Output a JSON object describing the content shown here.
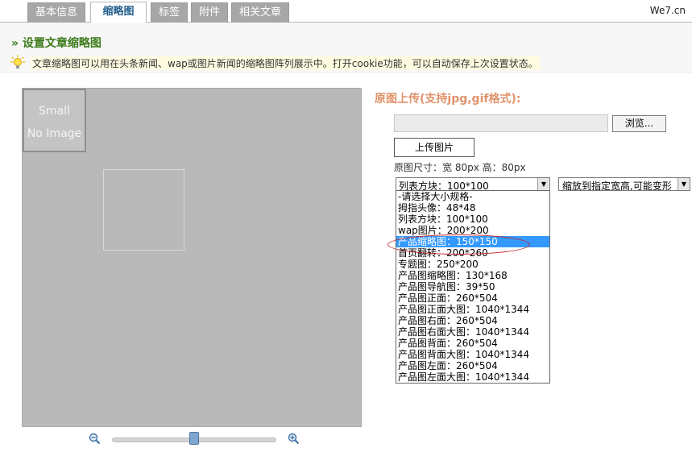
{
  "tabs": [
    {
      "label": "基本信息",
      "active": false
    },
    {
      "label": "缩略图",
      "active": true
    },
    {
      "label": "标签",
      "active": false
    },
    {
      "label": "附件",
      "active": false
    },
    {
      "label": "相关文章",
      "active": false
    }
  ],
  "brand": "We7.cn",
  "section": {
    "title": "» 设置文章缩略图",
    "tip_icon": "lightbulb-icon",
    "tip": "文章缩略图可以用在头条新闻、wap或图片新闻的缩略图阵列展示中。打开cookie功能，可以自动保存上次设置状态。"
  },
  "preview": {
    "placeholder_line1": "Small",
    "placeholder_line2": "No Image",
    "zoom_out_icon": "zoom-out-icon",
    "zoom_in_icon": "zoom-in-icon",
    "zoom_level": 0.5
  },
  "upload": {
    "title": "原图上传(支持jpg,gif格式):",
    "file_value": "",
    "browse_label": "浏览...",
    "upload_label": "上传图片",
    "size_info": "原图尺寸：宽 80px 高：80px"
  },
  "size_select": {
    "selected": "列表方块：100*100",
    "options": [
      "-请选择大小规格-",
      "拇指头像：48*48",
      "列表方块：100*100",
      "wap图片：200*200",
      "产品缩略图：150*150",
      "首页翻转：200*260",
      "专题图：250*200",
      "产品图缩略图：130*168",
      "产品图导航图：39*50",
      "产品图正面：260*504",
      "产品图正面大图：1040*1344",
      "产品图右面：260*504",
      "产品图右面大图：1040*1344",
      "产品图背面：260*504",
      "产品图背面大图：1040*1344",
      "产品图左面：260*504",
      "产品图左面大图：1040*1344"
    ],
    "highlighted_index": 4
  },
  "mode_select": {
    "selected": "缩放到指定宽高,可能变形"
  },
  "colors": {
    "accent_green": "#3c7a1a",
    "upload_title": "#e0936a",
    "highlight": "#3399ff",
    "annotation_red": "#c0282b"
  }
}
